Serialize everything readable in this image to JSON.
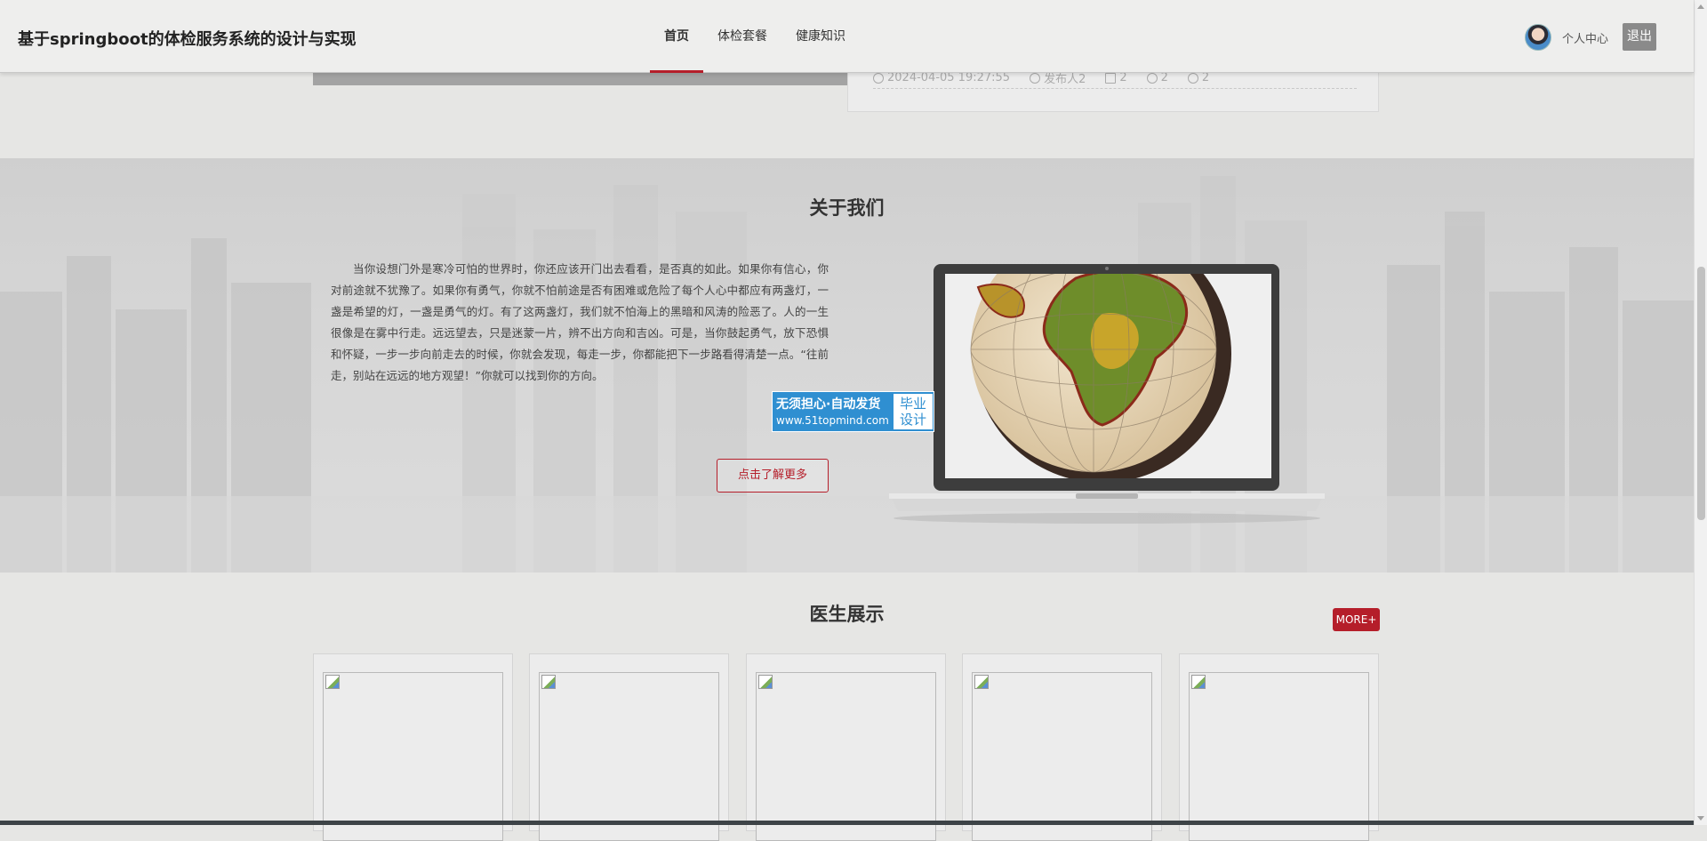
{
  "header": {
    "title": "基于springboot的体检服务系统的设计与实现",
    "nav": [
      {
        "label": "首页",
        "active": true
      },
      {
        "label": "体检套餐",
        "active": false
      },
      {
        "label": "健康知识",
        "active": false
      }
    ],
    "user_center": "个人中心",
    "logout": "退出"
  },
  "news_meta": {
    "date": "2024-04-05 19:27:55",
    "author": "发布人2",
    "collect": "2",
    "likes": "2",
    "views": "2"
  },
  "about": {
    "title": "关于我们",
    "text": "当你设想门外是寒冷可怕的世界时，你还应该开门出去看看，是否真的如此。如果你有信心，你对前途就不犹豫了。如果你有勇气，你就不怕前途是否有困难或危险了每个人心中都应有两盏灯，一盏是希望的灯，一盏是勇气的灯。有了这两盏灯，我们就不怕海上的黑暗和风涛的险恶了。人的一生很像是在雾中行走。远远望去，只是迷蒙一片，辨不出方向和吉凶。可是，当你鼓起勇气，放下恐惧和怀疑，一步一步向前走去的时候，你就会发现，每走一步，你都能把下一步路看得清楚一点。“往前走，别站在远远的地方观望！”你就可以找到你的方向。",
    "more_button": "点击了解更多",
    "watermark": {
      "line1": "无须担心·自动发货",
      "url": "www.51topmind.com",
      "right": "毕业设计"
    }
  },
  "doctors": {
    "title": "医生展示",
    "more": "MORE+",
    "cards": [
      {},
      {},
      {},
      {},
      {}
    ]
  },
  "colors": {
    "accent": "#b51e2a",
    "watermark": "#2f8fd1"
  }
}
